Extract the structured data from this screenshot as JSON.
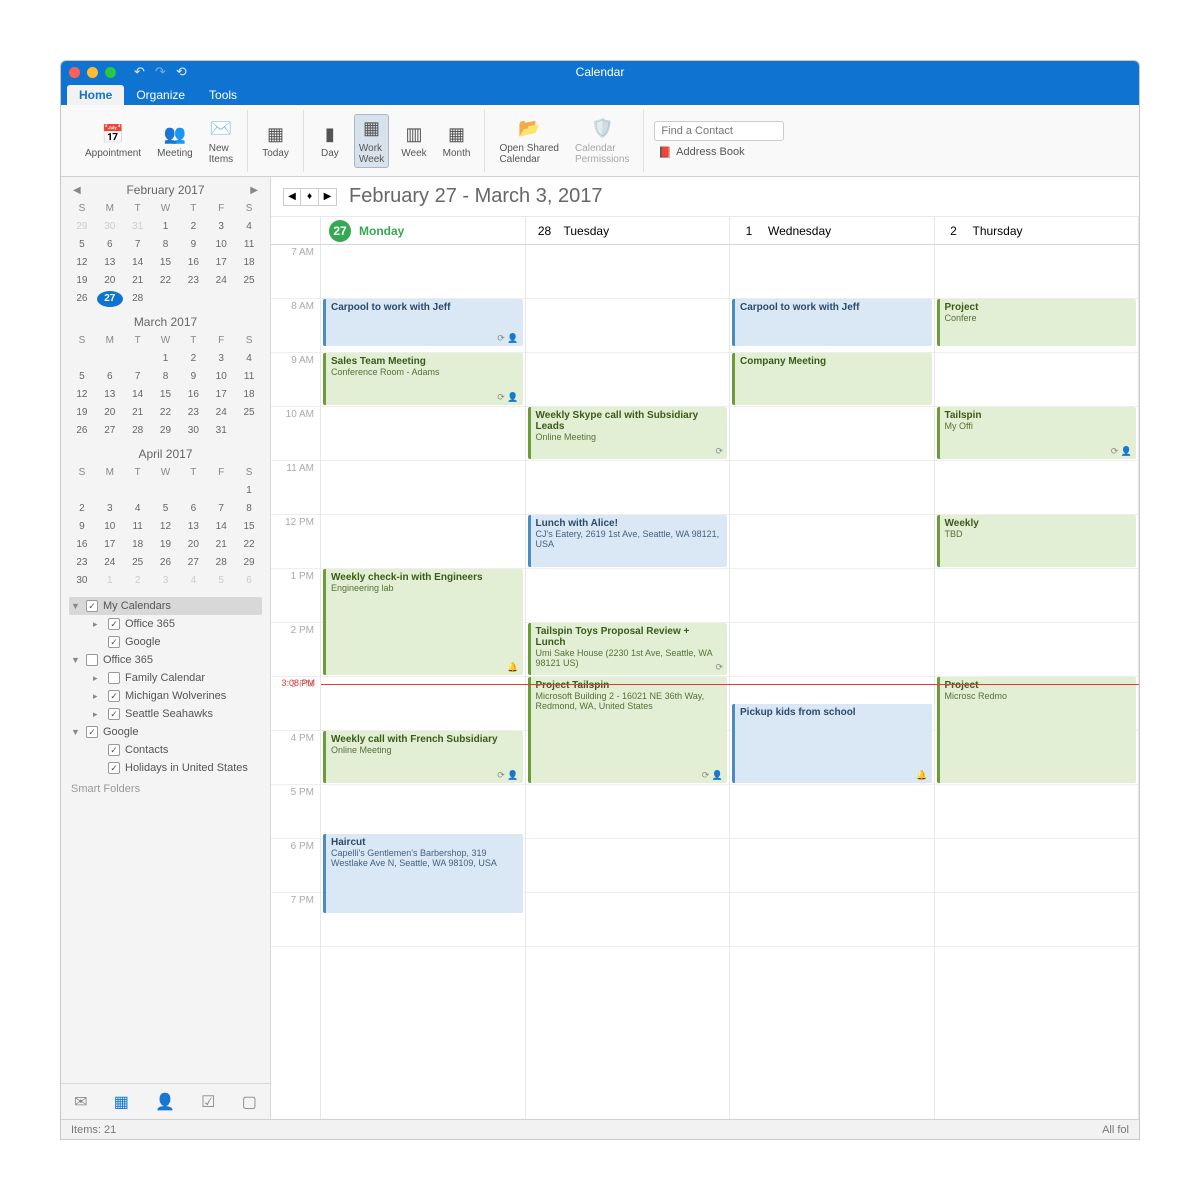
{
  "window": {
    "title": "Calendar"
  },
  "menubar": {
    "tabs": [
      "Home",
      "Organize",
      "Tools"
    ],
    "active": 0
  },
  "ribbon": {
    "appointment": "Appointment",
    "meeting": "Meeting",
    "new_items": "New\nItems",
    "today": "Today",
    "day": "Day",
    "work_week": "Work\nWeek",
    "week": "Week",
    "month": "Month",
    "open_shared": "Open Shared\nCalendar",
    "permissions": "Calendar\nPermissions",
    "find_placeholder": "Find a Contact",
    "address_book": "Address Book"
  },
  "mini_cals": [
    {
      "title": "February 2017",
      "nav": true,
      "weeks": [
        [
          "29",
          "30",
          "31",
          "1",
          "2",
          "3",
          "4"
        ],
        [
          "5",
          "6",
          "7",
          "8",
          "9",
          "10",
          "11"
        ],
        [
          "12",
          "13",
          "14",
          "15",
          "16",
          "17",
          "18"
        ],
        [
          "19",
          "20",
          "21",
          "22",
          "23",
          "24",
          "25"
        ],
        [
          "26",
          "27",
          "28",
          "",
          "",
          "",
          ""
        ]
      ],
      "out_start": 3,
      "today": "27"
    },
    {
      "title": "March 2017",
      "weeks": [
        [
          "",
          "",
          "",
          "1",
          "2",
          "3",
          "4"
        ],
        [
          "5",
          "6",
          "7",
          "8",
          "9",
          "10",
          "11"
        ],
        [
          "12",
          "13",
          "14",
          "15",
          "16",
          "17",
          "18"
        ],
        [
          "19",
          "20",
          "21",
          "22",
          "23",
          "24",
          "25"
        ],
        [
          "26",
          "27",
          "28",
          "29",
          "30",
          "31",
          ""
        ]
      ]
    },
    {
      "title": "April 2017",
      "weeks": [
        [
          "",
          "",
          "",
          "",
          "",
          "",
          "1"
        ],
        [
          "2",
          "3",
          "4",
          "5",
          "6",
          "7",
          "8"
        ],
        [
          "9",
          "10",
          "11",
          "12",
          "13",
          "14",
          "15"
        ],
        [
          "16",
          "17",
          "18",
          "19",
          "20",
          "21",
          "22"
        ],
        [
          "23",
          "24",
          "25",
          "26",
          "27",
          "28",
          "29"
        ],
        [
          "30",
          "1",
          "2",
          "3",
          "4",
          "5",
          "6"
        ]
      ],
      "out_tail": 6
    }
  ],
  "day_labels": [
    "S",
    "M",
    "T",
    "W",
    "T",
    "F",
    "S"
  ],
  "tree": [
    {
      "label": "My Calendars",
      "checked": true,
      "selected": true,
      "expand": true,
      "children": [
        {
          "label": "Office 365",
          "checked": true,
          "expand": false
        },
        {
          "label": "Google",
          "checked": true
        }
      ]
    },
    {
      "label": "Office 365",
      "checked": false,
      "expand": true,
      "children": [
        {
          "label": "Family Calendar",
          "checked": false,
          "expand": false
        },
        {
          "label": "Michigan Wolverines",
          "checked": true,
          "expand": false
        },
        {
          "label": "Seattle Seahawks",
          "checked": true,
          "expand": false
        }
      ]
    },
    {
      "label": "Google",
      "checked": true,
      "expand": true,
      "children": [
        {
          "label": "Contacts",
          "checked": true
        },
        {
          "label": "Holidays in United States",
          "checked": true
        }
      ]
    }
  ],
  "smart_folders": "Smart Folders",
  "range": "February 27 - March 3, 2017",
  "days": [
    {
      "num": "27",
      "name": "Monday",
      "today": true
    },
    {
      "num": "28",
      "name": "Tuesday"
    },
    {
      "num": "1",
      "name": "Wednesday"
    },
    {
      "num": "2",
      "name": "Thursday"
    }
  ],
  "hours": [
    "7 AM",
    "8 AM",
    "9 AM",
    "10 AM",
    "11 AM",
    "12 PM",
    "1 PM",
    "2 PM",
    "3 PM",
    "4 PM",
    "5 PM",
    "6 PM",
    "7 PM"
  ],
  "now": {
    "label": "3:08 PM",
    "hour": 8.13
  },
  "events": [
    {
      "day": 0,
      "start": 1.0,
      "dur": 0.9,
      "color": "blue",
      "title": "Carpool to work with Jeff",
      "icons": "⟳ 👤"
    },
    {
      "day": 0,
      "start": 2.0,
      "dur": 1.0,
      "color": "green",
      "title": "Sales Team Meeting",
      "loc": "Conference Room - Adams",
      "icons": "⟳ 👤"
    },
    {
      "day": 0,
      "start": 6.0,
      "dur": 2.0,
      "color": "green",
      "title": "Weekly check-in with Engineers",
      "loc": "Engineering lab",
      "icons": "🔔"
    },
    {
      "day": 0,
      "start": 9.0,
      "dur": 1.0,
      "color": "green",
      "title": "Weekly call with French Subsidiary",
      "loc": "Online Meeting",
      "icons": "⟳ 👤"
    },
    {
      "day": 0,
      "start": 10.9,
      "dur": 1.5,
      "color": "blue",
      "title": "Haircut",
      "loc": "Capelli's Gentlemen's Barbershop, 319 Westlake Ave N, Seattle, WA 98109, USA"
    },
    {
      "day": 1,
      "start": 3.0,
      "dur": 1.0,
      "color": "green",
      "title": "Weekly Skype call with Subsidiary Leads",
      "loc": "Online Meeting",
      "icons": "⟳"
    },
    {
      "day": 1,
      "start": 5.0,
      "dur": 1.0,
      "color": "blue",
      "title": "Lunch with Alice!",
      "loc": "CJ's Eatery, 2619 1st Ave, Seattle, WA 98121, USA"
    },
    {
      "day": 1,
      "start": 7.0,
      "dur": 1.0,
      "color": "green",
      "title": "Tailspin Toys Proposal Review + Lunch",
      "loc": "Umi Sake House (2230 1st Ave, Seattle, WA 98121 US)",
      "icons": "⟳"
    },
    {
      "day": 1,
      "start": 8.0,
      "dur": 2.0,
      "color": "green",
      "title": "Project Tailspin",
      "loc": "Microsoft Building 2 - 16021 NE 36th Way, Redmond, WA, United States",
      "icons": "⟳ 👤"
    },
    {
      "day": 2,
      "start": 1.0,
      "dur": 0.9,
      "color": "blue",
      "title": "Carpool to work with Jeff"
    },
    {
      "day": 2,
      "start": 2.0,
      "dur": 1.0,
      "color": "green",
      "title": "Company Meeting"
    },
    {
      "day": 2,
      "start": 8.5,
      "dur": 1.5,
      "color": "blue",
      "title": "Pickup kids from school",
      "icons": "🔔"
    },
    {
      "day": 3,
      "start": 1.0,
      "dur": 0.9,
      "color": "green",
      "title": "Project",
      "loc": "Confere"
    },
    {
      "day": 3,
      "start": 3.0,
      "dur": 1.0,
      "color": "green",
      "title": "Tailspin",
      "loc": "My Offi",
      "icons": "⟳ 👤"
    },
    {
      "day": 3,
      "start": 5.0,
      "dur": 1.0,
      "color": "green",
      "title": "Weekly",
      "loc": "TBD"
    },
    {
      "day": 3,
      "start": 8.0,
      "dur": 2.0,
      "color": "green",
      "title": "Project",
      "loc": "Microsc Redmo"
    }
  ],
  "status": {
    "items": "Items: 21",
    "right": "All fol"
  }
}
